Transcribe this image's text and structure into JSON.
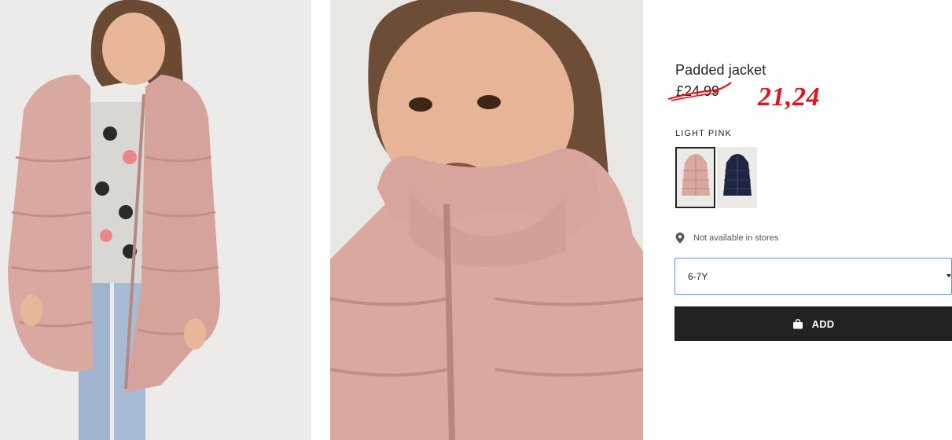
{
  "product": {
    "title": "Padded jacket",
    "old_price": "£24.99",
    "new_price_annotation": "21,24",
    "color_label": "LIGHT PINK",
    "swatches": [
      {
        "color": "#d9a8a1",
        "name": "light-pink"
      },
      {
        "color": "#1f2540",
        "name": "navy"
      }
    ],
    "availability": "Not available in stores",
    "size_selected": "6-7Y",
    "add_label": "ADD"
  },
  "colors": {
    "jacket_pink": "#d9a8a1",
    "navy": "#1f2540",
    "annotation_red": "#e8101a",
    "button_dark": "#222222",
    "select_border": "#5b8ee6"
  }
}
